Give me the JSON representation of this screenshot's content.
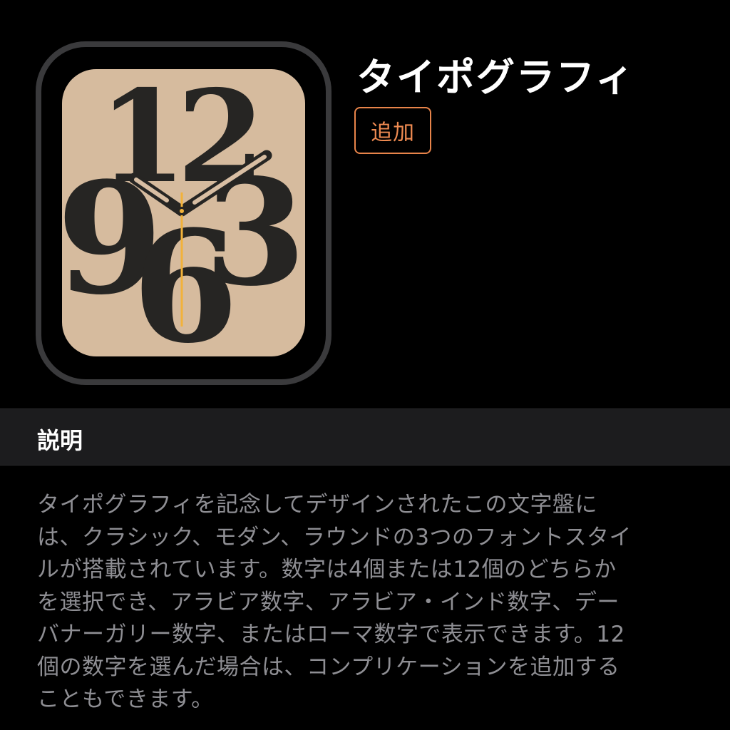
{
  "face": {
    "title": "タイポグラフィ",
    "add_label": "追加",
    "numerals": [
      "12",
      "9",
      "3",
      "6"
    ],
    "colors": {
      "dial": "#d6bb9e",
      "case": "#3a3a3c",
      "numeral": "#262523",
      "hands": "#262523",
      "hand_inlay": "#d8bea3",
      "second_hand": "#f2b23a",
      "accent": "#ef8b52"
    }
  },
  "description": {
    "header": "説明",
    "lines": [
      "タイポグラフィを記念してデザインされたこの文字盤に",
      "は、クラシック、モダン、ラウンドの3つのフォントスタイ",
      "ルが搭載されています。数字は4個または12個のどちらか",
      "を選択でき、アラビア数字、アラビア・インド数字、デー",
      "バナーガリー数字、またはローマ数字で表示できます。12",
      "個の数字を選んだ場合は、コンプリケーションを追加する",
      "こともできます。"
    ]
  }
}
